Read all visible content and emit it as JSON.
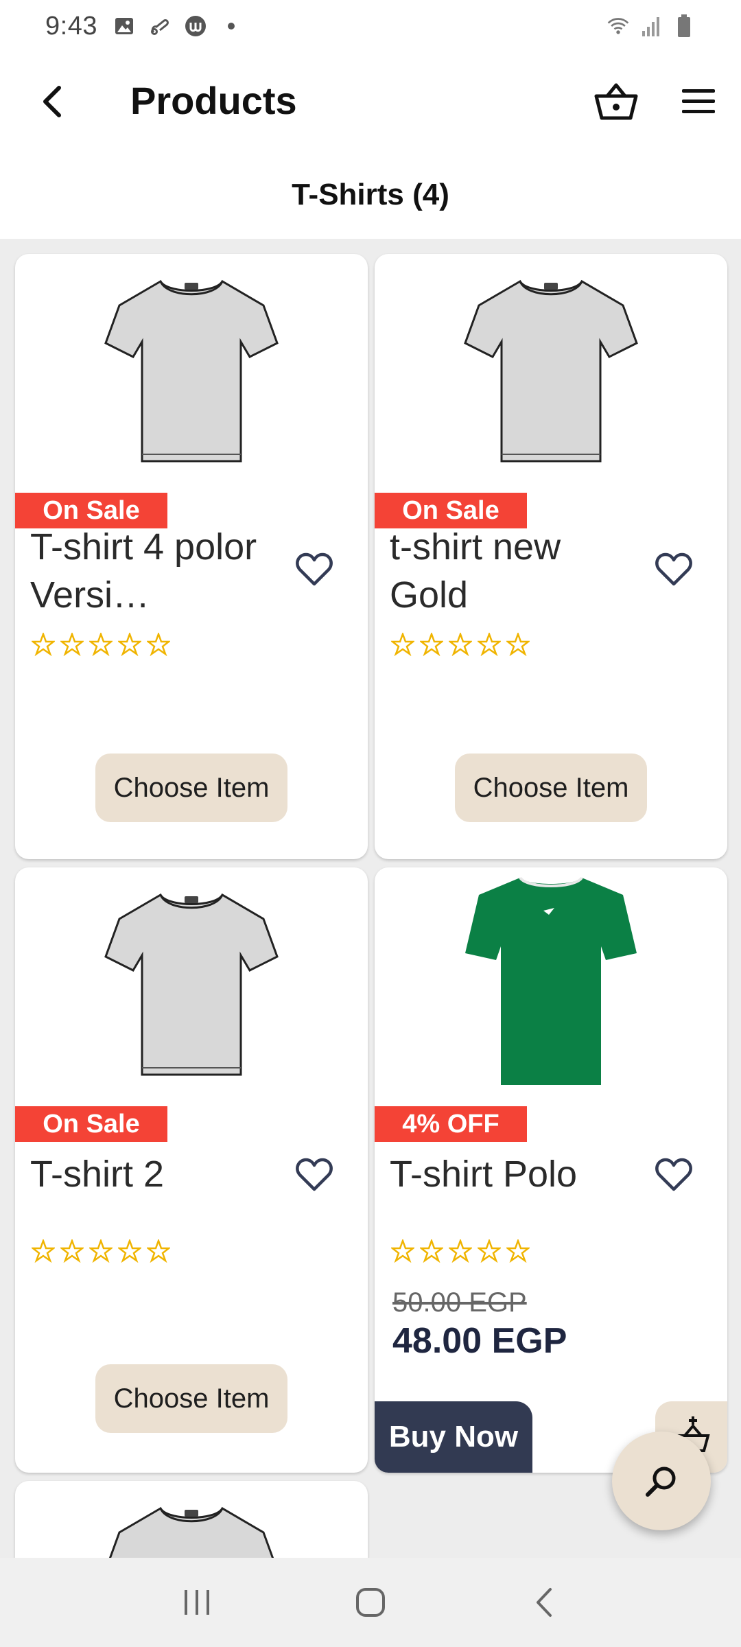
{
  "status_bar": {
    "time": "9:43",
    "left_icons": [
      "image-icon",
      "link-icon",
      "app-icon",
      "dot-icon"
    ],
    "right_icons": [
      "wifi-icon",
      "signal-icon",
      "battery-icon"
    ]
  },
  "app_bar": {
    "title": "Products",
    "back_icon": "chevron-left-icon",
    "basket_icon": "basket-icon",
    "menu_icon": "menu-icon"
  },
  "category": {
    "title": "T-Shirts (4)"
  },
  "products": [
    {
      "name": "T-shirt 4 polor Versi…",
      "badge": "On Sale",
      "rating": 0,
      "action_label": "Choose Item",
      "image": "grey-tshirt"
    },
    {
      "name": "t-shirt new Gold",
      "badge": "On Sale",
      "rating": 0,
      "action_label": "Choose Item",
      "image": "grey-tshirt"
    },
    {
      "name": "T-shirt 2",
      "badge": "On Sale",
      "rating": 0,
      "action_label": "Choose Item",
      "image": "grey-tshirt"
    },
    {
      "name": "T-shirt Polo",
      "badge": "4% OFF",
      "rating": 0,
      "old_price": "50.00 EGP",
      "new_price": "48.00 EGP",
      "action_label": "Buy Now",
      "image": "green-tshirt"
    },
    {
      "image": "grey-tshirt"
    }
  ],
  "colors": {
    "sale_badge": "#f44336",
    "choose_button": "#ebe0d1",
    "buy_now": "#323a52",
    "star": "#f0b400",
    "price": "#1f2640"
  },
  "fab": {
    "icon": "search-icon"
  },
  "nav_bar": {
    "icons": [
      "recent-apps-icon",
      "home-icon",
      "back-icon"
    ]
  }
}
